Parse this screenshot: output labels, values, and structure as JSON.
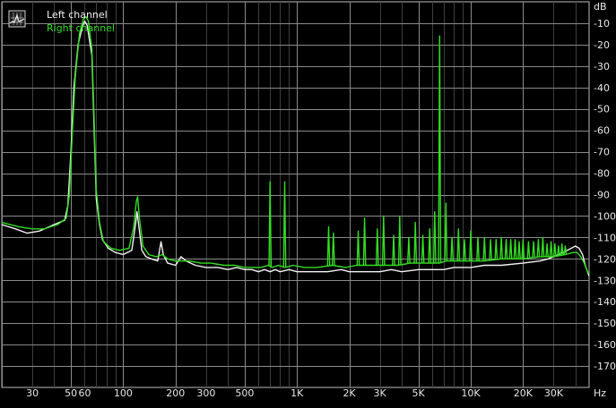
{
  "chart_data": {
    "type": "line",
    "x_scale": "log",
    "xlim": [
      20,
      48000
    ],
    "ylim": [
      -180,
      0
    ],
    "y_unit": "dB",
    "x_unit": "Hz",
    "grid": true,
    "legend": "top-left",
    "y_ticks": [
      -10,
      -20,
      -30,
      -40,
      -50,
      -60,
      -70,
      -80,
      -90,
      -100,
      -110,
      -120,
      -130,
      -140,
      -150,
      -160,
      -170
    ],
    "x_ticks": [
      {
        "value": 30,
        "label": "30"
      },
      {
        "value": 50,
        "label": "50"
      },
      {
        "value": 60,
        "label": "60"
      },
      {
        "value": 100,
        "label": "100"
      },
      {
        "value": 200,
        "label": "200"
      },
      {
        "value": 300,
        "label": "300"
      },
      {
        "value": 500,
        "label": "500"
      },
      {
        "value": 1000,
        "label": "1K"
      },
      {
        "value": 2000,
        "label": "2K"
      },
      {
        "value": 3000,
        "label": "3K"
      },
      {
        "value": 5000,
        "label": "5K"
      },
      {
        "value": 10000,
        "label": "10K"
      },
      {
        "value": 20000,
        "label": "20K"
      },
      {
        "value": 30000,
        "label": "30K"
      }
    ],
    "series": [
      {
        "name": "Left channel",
        "color": "#f2f2f2",
        "points": [
          [
            20,
            -104
          ],
          [
            24,
            -106
          ],
          [
            28,
            -108
          ],
          [
            33,
            -107
          ],
          [
            40,
            -104
          ],
          [
            46,
            -102
          ],
          [
            48,
            -95
          ],
          [
            50,
            -70
          ],
          [
            52,
            -40
          ],
          [
            55,
            -20
          ],
          [
            58,
            -12
          ],
          [
            60,
            -9
          ],
          [
            62,
            -11
          ],
          [
            66,
            -25
          ],
          [
            68,
            -60
          ],
          [
            70,
            -92
          ],
          [
            73,
            -104
          ],
          [
            76,
            -111
          ],
          [
            82,
            -115
          ],
          [
            90,
            -117
          ],
          [
            100,
            -118
          ],
          [
            112,
            -116
          ],
          [
            118,
            -103
          ],
          [
            120,
            -98
          ],
          [
            123,
            -105
          ],
          [
            128,
            -116
          ],
          [
            135,
            -119
          ],
          [
            145,
            -120
          ],
          [
            158,
            -121
          ],
          [
            165,
            -112
          ],
          [
            170,
            -118
          ],
          [
            180,
            -122
          ],
          [
            200,
            -123
          ],
          [
            215,
            -119
          ],
          [
            230,
            -121
          ],
          [
            260,
            -123
          ],
          [
            300,
            -124
          ],
          [
            350,
            -124
          ],
          [
            400,
            -125
          ],
          [
            450,
            -124
          ],
          [
            500,
            -125
          ],
          [
            550,
            -125
          ],
          [
            600,
            -126
          ],
          [
            650,
            -125
          ],
          [
            700,
            -126
          ],
          [
            750,
            -125
          ],
          [
            800,
            -126
          ],
          [
            900,
            -125
          ],
          [
            1000,
            -126
          ],
          [
            1200,
            -126
          ],
          [
            1500,
            -126
          ],
          [
            1800,
            -125
          ],
          [
            2000,
            -126
          ],
          [
            2500,
            -126
          ],
          [
            3000,
            -126
          ],
          [
            3500,
            -125
          ],
          [
            4000,
            -126
          ],
          [
            5000,
            -125
          ],
          [
            6000,
            -125
          ],
          [
            6500,
            -125
          ],
          [
            7000,
            -125
          ],
          [
            8000,
            -124
          ],
          [
            10000,
            -124
          ],
          [
            12000,
            -123
          ],
          [
            15000,
            -123
          ],
          [
            20000,
            -122
          ],
          [
            25000,
            -121
          ],
          [
            28000,
            -120
          ],
          [
            32000,
            -118
          ],
          [
            36000,
            -116
          ],
          [
            38000,
            -115
          ],
          [
            40000,
            -114
          ],
          [
            42000,
            -115
          ],
          [
            44000,
            -118
          ],
          [
            46000,
            -124
          ],
          [
            48000,
            -128
          ]
        ]
      },
      {
        "name": "Right channel",
        "color": "#33dd22",
        "points": [
          [
            20,
            -103
          ],
          [
            25,
            -105
          ],
          [
            30,
            -106
          ],
          [
            35,
            -106
          ],
          [
            42,
            -104
          ],
          [
            47,
            -101
          ],
          [
            49,
            -90
          ],
          [
            51,
            -60
          ],
          [
            53,
            -35
          ],
          [
            56,
            -15
          ],
          [
            59,
            -8
          ],
          [
            61,
            -7
          ],
          [
            63,
            -9
          ],
          [
            66,
            -22
          ],
          [
            68,
            -55
          ],
          [
            70,
            -88
          ],
          [
            73,
            -103
          ],
          [
            77,
            -112
          ],
          [
            85,
            -115
          ],
          [
            95,
            -116
          ],
          [
            108,
            -115
          ],
          [
            115,
            -105
          ],
          [
            119,
            -93
          ],
          [
            121,
            -91
          ],
          [
            124,
            -101
          ],
          [
            130,
            -114
          ],
          [
            140,
            -118
          ],
          [
            155,
            -119
          ],
          [
            168,
            -118
          ],
          [
            180,
            -120
          ],
          [
            200,
            -121
          ],
          [
            240,
            -121
          ],
          [
            280,
            -122
          ],
          [
            320,
            -122
          ],
          [
            380,
            -123
          ],
          [
            440,
            -123
          ],
          [
            500,
            -124
          ],
          [
            560,
            -124
          ],
          [
            620,
            -124
          ],
          [
            680,
            -123
          ],
          [
            720,
            -124
          ],
          [
            780,
            -123
          ],
          [
            850,
            -124
          ],
          [
            950,
            -123
          ],
          [
            1100,
            -124
          ],
          [
            1300,
            -124
          ],
          [
            1600,
            -123
          ],
          [
            1900,
            -124
          ],
          [
            2200,
            -123
          ],
          [
            2700,
            -123
          ],
          [
            3200,
            -123
          ],
          [
            3800,
            -123
          ],
          [
            4500,
            -122
          ],
          [
            5500,
            -122
          ],
          [
            6200,
            -122
          ],
          [
            6600,
            -122
          ],
          [
            7200,
            -121
          ],
          [
            8500,
            -121
          ],
          [
            10000,
            -121
          ],
          [
            12000,
            -121
          ],
          [
            15000,
            -120
          ],
          [
            20000,
            -120
          ],
          [
            25000,
            -119
          ],
          [
            30000,
            -119
          ],
          [
            35000,
            -118
          ],
          [
            39000,
            -117
          ],
          [
            41000,
            -117
          ],
          [
            43000,
            -119
          ],
          [
            45000,
            -122
          ],
          [
            47000,
            -126
          ],
          [
            48000,
            -127
          ]
        ],
        "spikes": [
          [
            700,
            -84
          ],
          [
            850,
            -84
          ],
          [
            1520,
            -105
          ],
          [
            1620,
            -108
          ],
          [
            2250,
            -107
          ],
          [
            2450,
            -101
          ],
          [
            2900,
            -106
          ],
          [
            3150,
            -100
          ],
          [
            3600,
            -109
          ],
          [
            3900,
            -100
          ],
          [
            4400,
            -110
          ],
          [
            4800,
            -103
          ],
          [
            5300,
            -109
          ],
          [
            5800,
            -106
          ],
          [
            6200,
            -98
          ],
          [
            6620,
            -16
          ],
          [
            7200,
            -94
          ],
          [
            7800,
            -110
          ],
          [
            8500,
            -106
          ],
          [
            9200,
            -111
          ],
          [
            10000,
            -107
          ],
          [
            11000,
            -110
          ],
          [
            12000,
            -110
          ],
          [
            13000,
            -111
          ],
          [
            14000,
            -111
          ],
          [
            15000,
            -110
          ],
          [
            16000,
            -111
          ],
          [
            17000,
            -111
          ],
          [
            18000,
            -111
          ],
          [
            19000,
            -112
          ],
          [
            20000,
            -111
          ],
          [
            21500,
            -112
          ],
          [
            23000,
            -112
          ],
          [
            24500,
            -111
          ],
          [
            26000,
            -110
          ],
          [
            27500,
            -113
          ],
          [
            29000,
            -112
          ],
          [
            30500,
            -113
          ],
          [
            32000,
            -114
          ],
          [
            33500,
            -113
          ],
          [
            35000,
            -114
          ]
        ]
      }
    ]
  }
}
